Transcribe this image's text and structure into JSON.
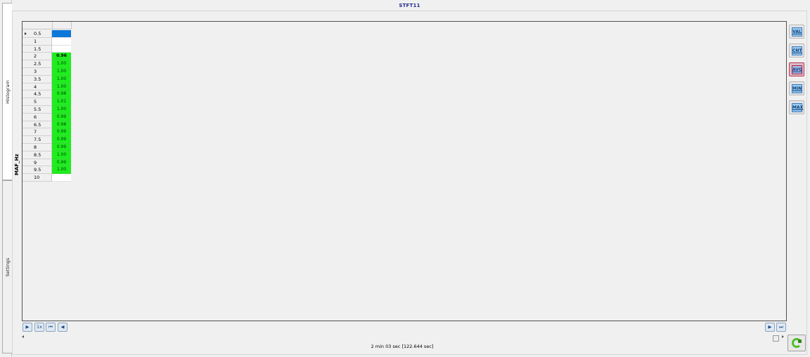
{
  "window": {
    "title": "STFT11"
  },
  "side_tabs": [
    {
      "label": "Histogram"
    },
    {
      "label": "Settings"
    }
  ],
  "table": {
    "y_axis_label": "MAF_Hz",
    "rows": [
      {
        "key": "0.5",
        "value": "",
        "style": "selected"
      },
      {
        "key": "1",
        "value": "",
        "style": "empty"
      },
      {
        "key": "1.5",
        "value": "",
        "style": "empty"
      },
      {
        "key": "2",
        "value": "0.96",
        "style": "green-bold"
      },
      {
        "key": "2.5",
        "value": "1.00",
        "style": "green"
      },
      {
        "key": "3",
        "value": "1.00",
        "style": "green"
      },
      {
        "key": "3.5",
        "value": "1.00",
        "style": "green"
      },
      {
        "key": "4",
        "value": "1.00",
        "style": "green"
      },
      {
        "key": "4.5",
        "value": "0.98",
        "style": "green"
      },
      {
        "key": "5",
        "value": "1.01",
        "style": "green"
      },
      {
        "key": "5.5",
        "value": "1.00",
        "style": "green"
      },
      {
        "key": "6",
        "value": "0.99",
        "style": "green"
      },
      {
        "key": "6.5",
        "value": "0.98",
        "style": "green"
      },
      {
        "key": "7",
        "value": "0.99",
        "style": "green"
      },
      {
        "key": "7.5",
        "value": "0.99",
        "style": "green"
      },
      {
        "key": "8",
        "value": "0.99",
        "style": "green"
      },
      {
        "key": "8.5",
        "value": "1.00",
        "style": "green"
      },
      {
        "key": "9",
        "value": "0.99",
        "style": "green"
      },
      {
        "key": "9.5",
        "value": "1.00",
        "style": "green"
      },
      {
        "key": "10",
        "value": "",
        "style": "empty"
      }
    ]
  },
  "right_toolbar": [
    {
      "label": "VAL",
      "active": false
    },
    {
      "label": "CNT",
      "active": false
    },
    {
      "label": "AVG",
      "active": true
    },
    {
      "label": "MIN",
      "active": false
    },
    {
      "label": "MAX",
      "active": false
    }
  ],
  "bottom_nav": {
    "speed_label": "1x"
  },
  "status": {
    "duration": "2 min 03 sec [122.644 sec]"
  },
  "colors": {
    "title": "#202a8e",
    "cell_green": "#1eee1e",
    "selected": "#0a78d8"
  }
}
